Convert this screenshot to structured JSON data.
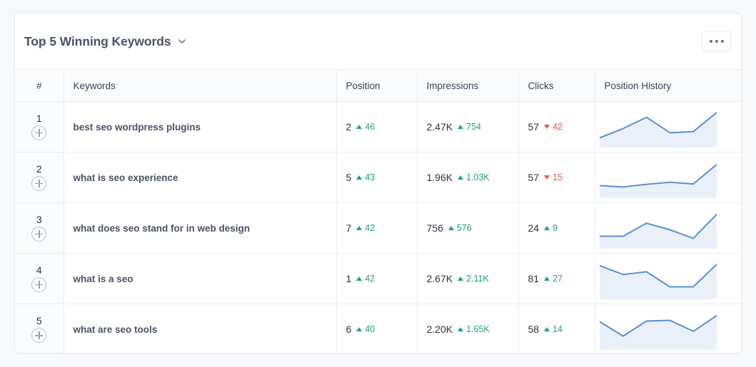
{
  "card": {
    "title": "Top 5 Winning Keywords",
    "title_chevron_icon": "chevron-down-icon",
    "menu_button_icon": "ellipsis-horizontal-icon"
  },
  "colors": {
    "up": "#21a179",
    "down": "#e8574a",
    "spark_line": "#5b8fd4",
    "spark_fill": "#eaf0fa",
    "card_border": "#e7eaef",
    "header_bg": "#fafbfc",
    "text": "#343a4d"
  },
  "table": {
    "columns": [
      {
        "key": "num",
        "label": "#"
      },
      {
        "key": "keyword",
        "label": "Keywords"
      },
      {
        "key": "position",
        "label": "Position"
      },
      {
        "key": "impressions",
        "label": "Impressions"
      },
      {
        "key": "clicks",
        "label": "Clicks"
      },
      {
        "key": "history",
        "label": "Position History"
      }
    ],
    "rows": [
      {
        "num": "1",
        "keyword": "best seo wordpress plugins",
        "position": {
          "value": "2",
          "delta": "46",
          "dir": "up"
        },
        "impressions": {
          "value": "2.47K",
          "delta": "754",
          "dir": "up"
        },
        "clicks": {
          "value": "57",
          "delta": "42",
          "dir": "down"
        },
        "history": [
          18,
          45,
          78,
          33,
          36,
          92
        ]
      },
      {
        "num": "2",
        "keyword": "what is seo experience",
        "position": {
          "value": "5",
          "delta": "43",
          "dir": "up"
        },
        "impressions": {
          "value": "1.96K",
          "delta": "1.03K",
          "dir": "up"
        },
        "clicks": {
          "value": "57",
          "delta": "15",
          "dir": "down"
        },
        "history": [
          26,
          22,
          30,
          36,
          31,
          88
        ]
      },
      {
        "num": "3",
        "keyword": "what does seo stand for in web design",
        "position": {
          "value": "7",
          "delta": "42",
          "dir": "up"
        },
        "impressions": {
          "value": "756",
          "delta": "576",
          "dir": "up"
        },
        "clicks": {
          "value": "24",
          "delta": "9",
          "dir": "up"
        },
        "history": [
          26,
          26,
          64,
          45,
          20,
          90
        ]
      },
      {
        "num": "4",
        "keyword": "what is a seo",
        "position": {
          "value": "1",
          "delta": "42",
          "dir": "up"
        },
        "impressions": {
          "value": "2.67K",
          "delta": "2.11K",
          "dir": "up"
        },
        "clicks": {
          "value": "81",
          "delta": "27",
          "dir": "up"
        },
        "history": [
          88,
          62,
          70,
          26,
          26,
          92
        ]
      },
      {
        "num": "5",
        "keyword": "what are seo tools",
        "position": {
          "value": "6",
          "delta": "40",
          "dir": "up"
        },
        "impressions": {
          "value": "2.20K",
          "delta": "1.65K",
          "dir": "up"
        },
        "clicks": {
          "value": "58",
          "delta": "14",
          "dir": "up"
        },
        "history": [
          72,
          30,
          74,
          76,
          44,
          90
        ]
      }
    ]
  }
}
